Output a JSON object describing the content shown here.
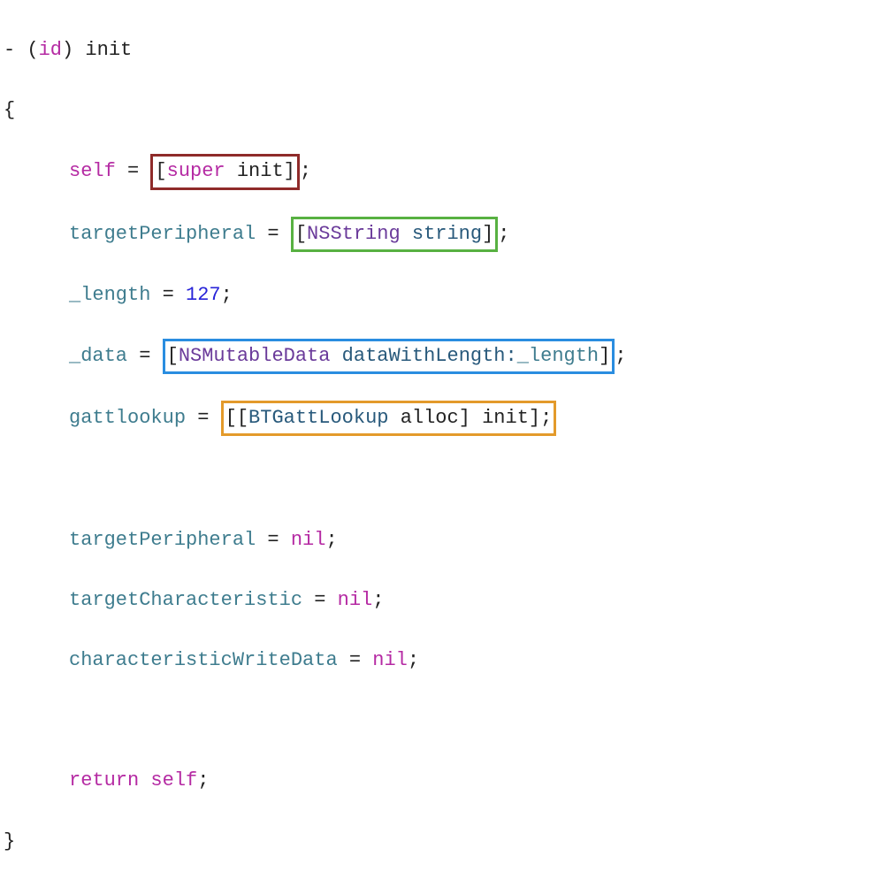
{
  "code": {
    "line1": {
      "dash": "- (",
      "ret": "id",
      "after_ret": ") init"
    },
    "line2": "{",
    "line3": {
      "selfKw": "self",
      "eq": " = ",
      "box": {
        "lb": "[",
        "superKw": "super",
        "sp": " ",
        "init": "init",
        "rb": "]"
      },
      "semi": ";"
    },
    "line4": {
      "var": "targetPeripheral",
      "eq": " = ",
      "box": {
        "lb": "[",
        "cls": "NSString",
        "sp": " ",
        "meth": "string",
        "rb": "]"
      },
      "semi": ";"
    },
    "line5": {
      "var": "_length",
      "eq": " = ",
      "num": "127",
      "semi": ";"
    },
    "line6": {
      "var": "_data",
      "eq": " = ",
      "box": {
        "lb": "[",
        "cls": "NSMutableData",
        "sp": " ",
        "meth": "dataWithLength:",
        "arg": "_length",
        "rb": "]"
      },
      "semi": ";"
    },
    "line7": {
      "var": "gattlookup",
      "eq": " = ",
      "box": {
        "lb": "[[",
        "cls": "BTGattLookup",
        "sp": " ",
        "alloc": "alloc",
        "mid": "] ",
        "init": "init",
        "rb": "];"
      }
    },
    "line8": {
      "var": "targetPeripheral",
      "eq": " = ",
      "nil": "nil",
      "semi": ";"
    },
    "line9": {
      "var": "targetCharacteristic",
      "eq": " = ",
      "nil": "nil",
      "semi": ";"
    },
    "line10": {
      "var": "characteristicWriteData",
      "eq": " = ",
      "nil": "nil",
      "semi": ";"
    },
    "line11": {
      "ret": "return",
      "sp": " ",
      "self": "self",
      "semi": ";"
    },
    "line12": "}"
  },
  "annotations": {
    "box1": "super-init",
    "box2": "nsstring-string",
    "box3": "nsmutabledata-datawithlength",
    "box4": "btgattlookup-alloc-init"
  }
}
